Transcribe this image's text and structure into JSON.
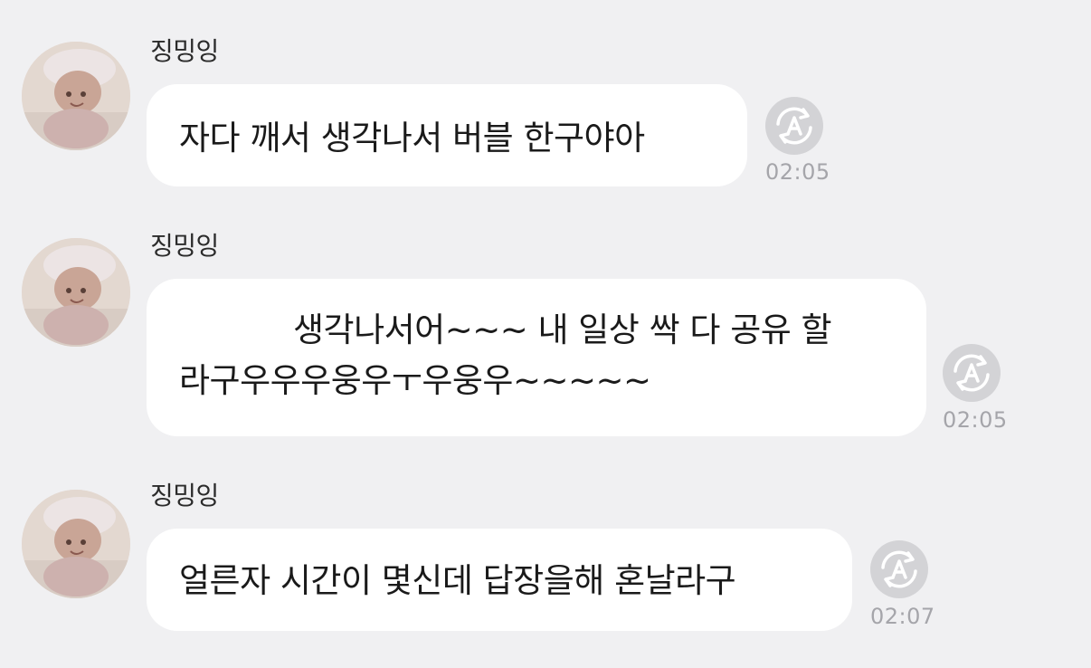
{
  "messages": [
    {
      "sender": "징밍잉",
      "lines": [
        "자다 깨서 생각나서 버블 한구야아"
      ],
      "time": "02:05",
      "has_redaction": false,
      "avatar_icon": "baby-photo-avatar",
      "reply_icon": "auto-translate-icon"
    },
    {
      "sender": "징밍잉",
      "lines": [
        "생각나서어~~~ 내 일상 싹 다 공유 할",
        "라구우우우웅우ㅜ우웅우~~~~~"
      ],
      "time": "02:05",
      "has_redaction": true,
      "avatar_icon": "baby-photo-avatar",
      "reply_icon": "auto-translate-icon"
    },
    {
      "sender": "징밍잉",
      "lines": [
        "얼른자 시간이 몇신데 답장을해 혼날라구"
      ],
      "time": "02:07",
      "has_redaction": false,
      "avatar_icon": "baby-photo-avatar",
      "reply_icon": "auto-translate-icon"
    }
  ],
  "colors": {
    "background": "#f0f0f2",
    "bubble": "#ffffff",
    "icon_circle": "#d3d3d6",
    "time_text": "#a5a5aa"
  }
}
